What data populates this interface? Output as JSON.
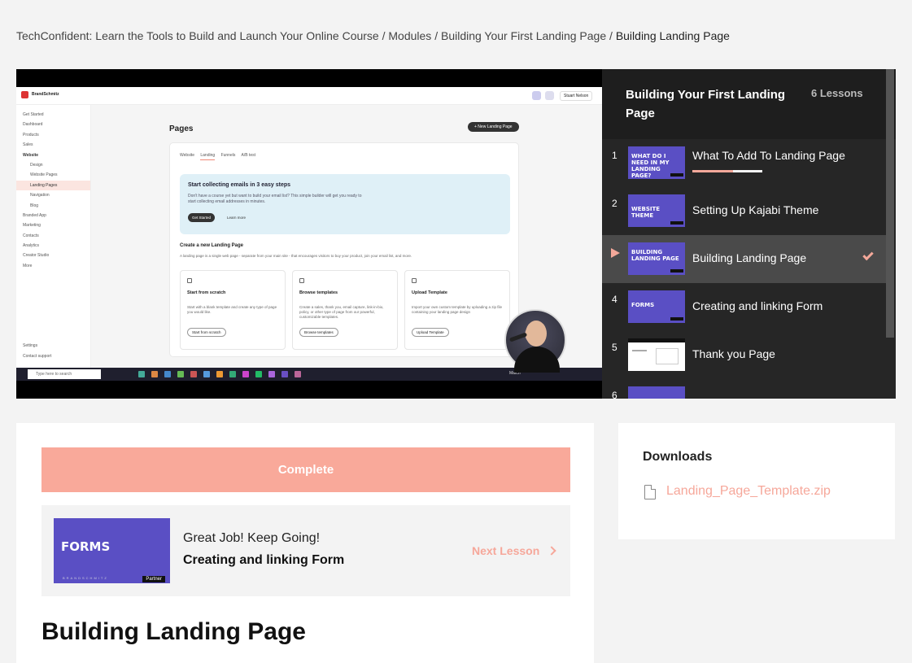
{
  "breadcrumb": {
    "course": "TechConfident: Learn the Tools to Build and Launch Your Online Course",
    "sep1": "/",
    "modules": "Modules",
    "sep2": "/",
    "module": "Building Your First Landing Page",
    "sep3": "/",
    "current": "Building Landing Page"
  },
  "video": {
    "brand": "BrandSchmitz",
    "top_nav": "Stuart Nelson",
    "sidebar": [
      {
        "label": "Get Started"
      },
      {
        "label": "Dashboard"
      },
      {
        "label": "Products"
      },
      {
        "label": "Sales"
      },
      {
        "label": "Website"
      },
      {
        "label": "Design"
      },
      {
        "label": "Website Pages"
      },
      {
        "label": "Landing Pages"
      },
      {
        "label": "Navigation"
      },
      {
        "label": "Blog"
      },
      {
        "label": "Branded App"
      },
      {
        "label": "Marketing"
      },
      {
        "label": "Contacts"
      },
      {
        "label": "Analytics"
      },
      {
        "label": "Creator Studio"
      },
      {
        "label": "More"
      }
    ],
    "sidebar_bottom": [
      "Settings",
      "Contact support"
    ],
    "page_title": "Pages",
    "new_button": "+ New Landing Page",
    "tabs": [
      "Website",
      "Landing",
      "Funnels",
      "A/B test"
    ],
    "banner_heading": "Start collecting emails in 3 easy steps",
    "banner_text": "Don't have a course yet but want to build your email list? This simple builder will get you ready to start collecting email addresses in minutes.",
    "banner_button": "Get Started",
    "banner_link": "Learn more",
    "create_heading": "Create a new Landing Page",
    "create_text": "A landing page is a single web page - separate from your main site - that encourages visitors to buy your product, join your email list, and more.",
    "options": [
      {
        "title": "Start from scratch",
        "desc": "Start with a blank template and create any type of page you would like.",
        "button": "Start from scratch"
      },
      {
        "title": "Browse templates",
        "desc": "Create a sales, thank you, email capture, link-in-bio, policy, or other type of page from our powerful, customizable templates.",
        "button": "Browse templates"
      },
      {
        "title": "Upload Template",
        "desc": "Import your own custom template by uploading a zip file containing your landing page design",
        "button": "Upload Template"
      }
    ],
    "taskbar_search": "Type here to search",
    "taskbar_weather": "Match"
  },
  "playlist": {
    "title": "Building Your First Landing Page",
    "count": "6 Lessons",
    "lessons": [
      {
        "num": "1",
        "title": "What To Add To Landing Page",
        "thumb": "WHAT DO I NEED IN MY LANDING PAGE?",
        "progress": 0.58
      },
      {
        "num": "2",
        "title": "Setting Up Kajabi Theme",
        "thumb": "WEBSITE THEME"
      },
      {
        "num": "",
        "title": "Building Landing Page",
        "thumb": "BUILDING LANDING PAGE",
        "completed": true
      },
      {
        "num": "4",
        "title": "Creating and linking Form",
        "thumb": "FORMS"
      },
      {
        "num": "5",
        "title": "Thank you Page",
        "thumb": ""
      },
      {
        "num": "6",
        "title": "",
        "thumb": ""
      }
    ]
  },
  "lesson": {
    "complete_label": "Complete",
    "next_heading": "Great Job! Keep Going!",
    "next_title": "Creating and linking Form",
    "next_link": "Next Lesson",
    "next_thumb_text": "FORMS",
    "next_thumb_brand": "BRANDSCHMITZ",
    "next_thumb_tag": "Partner",
    "title": "Building Landing Page"
  },
  "downloads": {
    "heading": "Downloads",
    "file": "Landing_Page_Template.zip"
  },
  "colors": {
    "accent": "#f9a99a",
    "thumb_purple": "#5a4fc4",
    "playlist_bg": "#262626"
  }
}
